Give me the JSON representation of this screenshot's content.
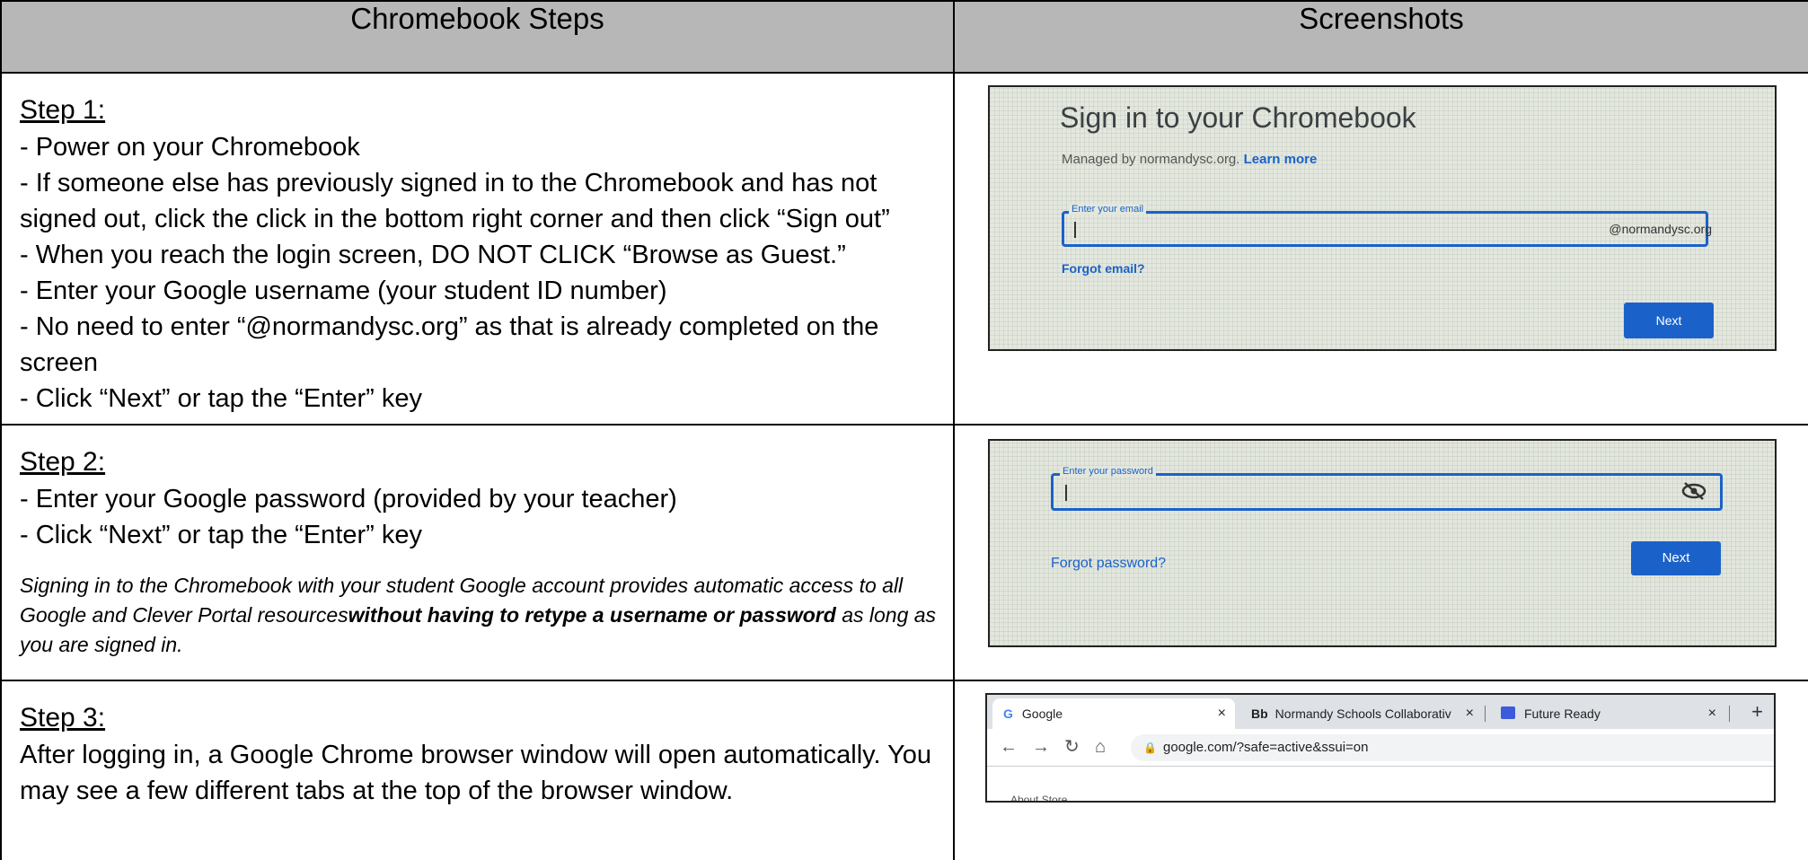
{
  "headers": {
    "left": "Chromebook Steps",
    "right": "Screenshots"
  },
  "step1": {
    "title": "Step 1:",
    "lines": [
      "- Power on your Chromebook",
      "- If someone else has previously signed in to the Chromebook and has not signed out, click the click in the bottom right corner and then click “Sign out”",
      "- When you reach the login screen, ",
      "DO NOT CLICK “Browse as Guest.”",
      "- Enter your Google username (your student ID number)",
      "- No need to enter “@normandysc.org” as that is already completed on the screen",
      "- Click “Next” or tap the “Enter” key"
    ]
  },
  "step2": {
    "title": "Step 2:",
    "lines": [
      "- Enter your Google password (provided by your teacher)",
      "- Click “Next” or tap the “Enter” key"
    ],
    "note_start": "Signing in to the Chromebook with your student Google account provides automatic access to all Google and Clever Portal resources",
    "note_bold": "without having to retype a username or password",
    "note_end": " as long as you are signed in."
  },
  "step3": {
    "title": "Step 3:",
    "text": "After logging in, a Google Chrome browser window will open automatically. You may see a few different tabs at the top of the browser window."
  },
  "shot1": {
    "title": "Sign in to your Chromebook",
    "managed": "Managed by normandysc.org. ",
    "learn_more": "Learn more",
    "email_label": "Enter your email",
    "domain": "@normandysc.org",
    "forgot": "Forgot email?",
    "next": "Next"
  },
  "shot2": {
    "password_label": "Enter your password",
    "forgot": "Forgot password?",
    "next": "Next"
  },
  "shot3": {
    "tabs": [
      {
        "icon": "G",
        "label": "Google"
      },
      {
        "icon": "Bb",
        "label": "Normandy Schools Collaborativ"
      },
      {
        "icon": "",
        "label": "Future Ready"
      }
    ],
    "url": "google.com/?safe=active&ssui=on",
    "below": "About    Store"
  },
  "colors": {
    "header_bg": "#b7b7b7",
    "google_blue": "#1a62c9"
  }
}
